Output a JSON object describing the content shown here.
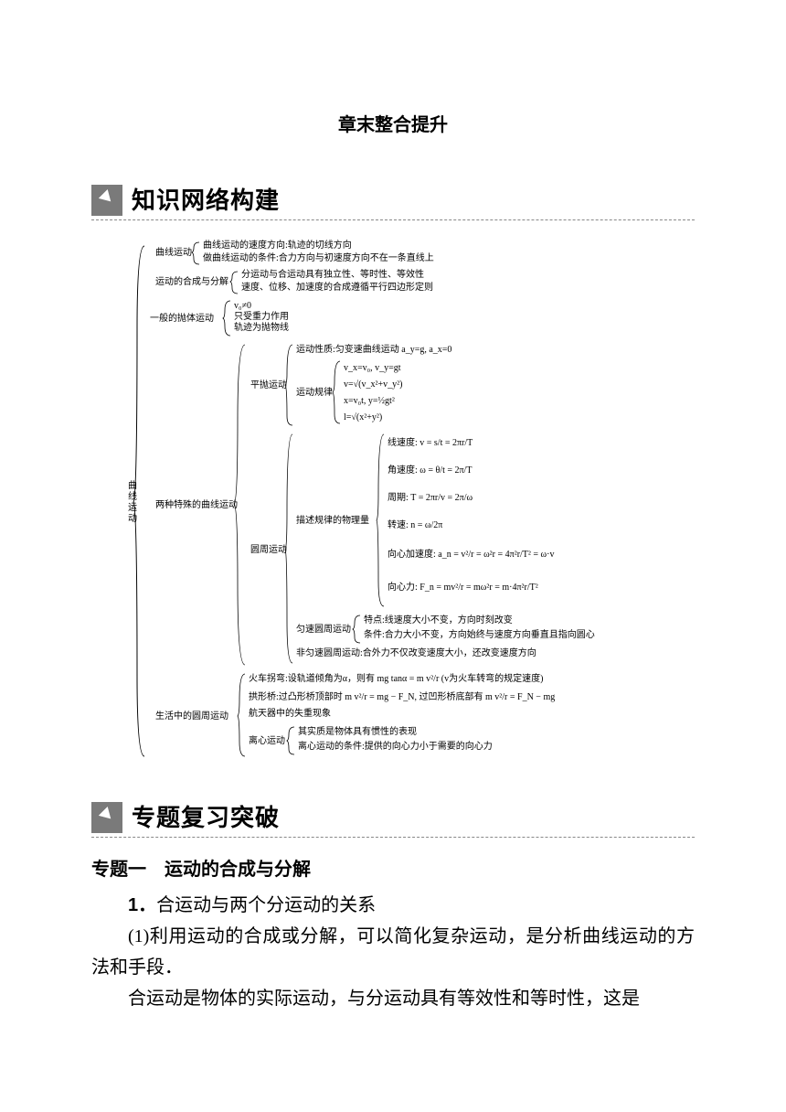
{
  "title": "章末整合提升",
  "section1": {
    "heading": "知识网络构建"
  },
  "diagram": {
    "root": "曲线运动",
    "b1": {
      "label": "曲线运动",
      "items": [
        "曲线运动的速度方向:轨迹的切线方向",
        "做曲线运动的条件:合力方向与初速度方向不在一条直线上"
      ]
    },
    "b2": {
      "label": "运动的合成与分解",
      "items": [
        "分运动与合运动具有独立性、等时性、等效性",
        "速度、位移、加速度的合成遵循平行四边形定则"
      ]
    },
    "b3": {
      "label": "一般的抛体运动",
      "items": [
        "v₀≠0",
        "只受重力作用",
        "轨迹为抛物线"
      ]
    },
    "b4": {
      "label": "两种特殊的曲线运动",
      "pp": {
        "label": "平抛运动",
        "nature": "运动性质:匀变速曲线运动 a_y=g, a_x=0",
        "laws_label": "运动规律",
        "laws": [
          "v_x=v₀, v_y=gt",
          "v=√(v_x²+v_y²)",
          "x=v₀t, y=½gt²",
          "l=√(x²+y²)"
        ]
      },
      "yz": {
        "label": "圆周运动",
        "desc_label": "描述规律的物理量",
        "desc": [
          "线速度: v = s/t = 2πr/T",
          "角速度: ω = θ/t = 2π/T",
          "周期: T = 2πr/v = 2π/ω",
          "转速: n = ω/2π",
          "向心加速度: a_n = v²/r = ω²r = 4π²r/T² = ω·v",
          "向心力: F_n = mv²/r = mω²r = m·4π²r/T²"
        ],
        "ys_label": "匀速圆周运动",
        "ys": [
          "特点:线速度大小不变，方向时刻改变",
          "条件:合力大小不变，方向始终与速度方向垂直且指向圆心"
        ],
        "fys": "非匀速圆周运动:合外力不仅改变速度大小，还改变速度方向"
      }
    },
    "b5": {
      "label": "生活中的圆周运动",
      "items": [
        "火车拐弯:设轨道倾角为α，则有 mg tanα = m v²/r (v为火车转弯的规定速度)",
        "拱形桥:过凸形桥顶部时 m v²/r = mg − F_N, 过凹形桥底部有 m v²/r = F_N − mg",
        "航天器中的失重现象"
      ],
      "lx_label": "离心运动",
      "lx": [
        "其实质是物体具有惯性的表现",
        "离心运动的条件:提供的向心力小于需要的向心力"
      ]
    }
  },
  "section2": {
    "heading": "专题复习突破"
  },
  "topic": {
    "label": "专题一　运动的合成与分解"
  },
  "body": {
    "p1_label": "1．",
    "p1": "合运动与两个分运动的关系",
    "p2": "(1)利用运动的合成或分解，可以简化复杂运动，是分析曲线运动的方法和手段．",
    "p3": "合运动是物体的实际运动，与分运动具有等效性和等时性，这是"
  }
}
